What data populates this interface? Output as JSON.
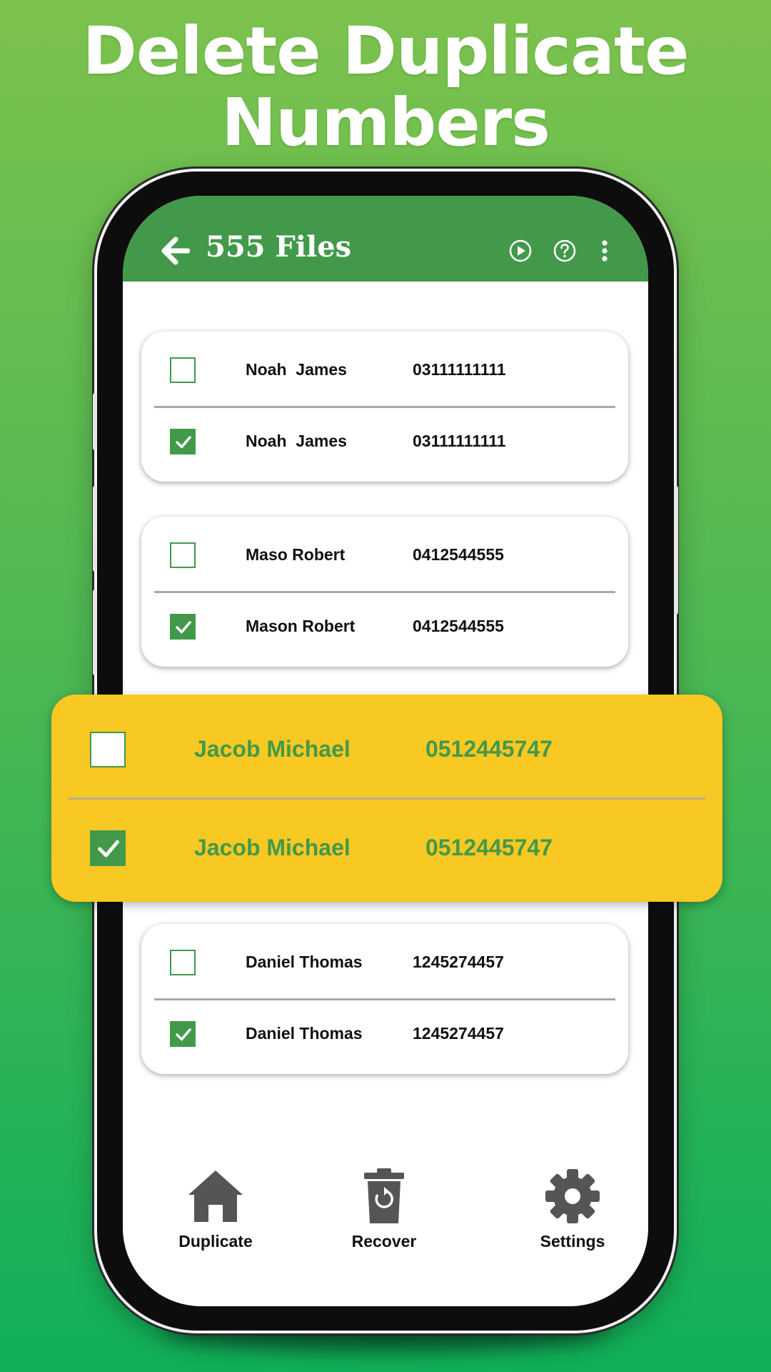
{
  "headline": {
    "line1": "Delete Duplicate",
    "line2": "Numbers"
  },
  "appbar": {
    "title": "555 Files",
    "icons": [
      "back-arrow-icon",
      "play-icon",
      "help-icon",
      "more-vertical-icon"
    ]
  },
  "groups": [
    {
      "rows": [
        {
          "name": "Noah  James",
          "number": "03111111111",
          "checked": false
        },
        {
          "name": "Noah  James",
          "number": "03111111111",
          "checked": true
        }
      ]
    },
    {
      "rows": [
        {
          "name": "Maso Robert",
          "number": "0412544555",
          "checked": false
        },
        {
          "name": "Mason Robert",
          "number": "0412544555",
          "checked": true
        }
      ]
    },
    {
      "rows": [
        {
          "name": "Jacob Michael",
          "number": "0512445747",
          "checked": false
        },
        {
          "name": "Jacob Michael",
          "number": "0512445747",
          "checked": true
        }
      ]
    },
    {
      "rows": [
        {
          "name": "Daniel Thomas",
          "number": "1245274457",
          "checked": false
        },
        {
          "name": "Daniel Thomas",
          "number": "1245274457",
          "checked": true
        }
      ]
    }
  ],
  "nav": {
    "duplicate": "Duplicate",
    "recover": "Recover",
    "settings": "Settings"
  },
  "colors": {
    "accent": "#43994a",
    "highlight": "#f8c823",
    "bg_top": "#7cc24d",
    "bg_bottom": "#10b05a"
  }
}
